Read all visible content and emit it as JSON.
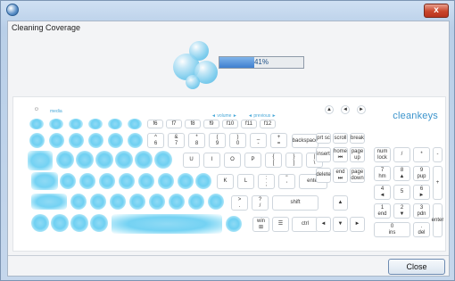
{
  "window": {
    "title_icon": "app-icon",
    "close_glyph": "x"
  },
  "section": {
    "title": "Cleaning Coverage"
  },
  "progress": {
    "percent": 41,
    "label": "41%"
  },
  "brand": {
    "logo": "cleankeys"
  },
  "labels": {
    "media": "media",
    "volume": "◄ volume ►",
    "previous": "◄ previous ►",
    "power": "⏻"
  },
  "keys": {
    "f6": "f6",
    "f7": "f7",
    "f8": "f8",
    "f9": "f9",
    "f10": "f10",
    "f11": "f11",
    "f12": "f12",
    "row2": [
      {
        "top": "^",
        "bottom": "6"
      },
      {
        "top": "&",
        "bottom": "7"
      },
      {
        "top": "*",
        "bottom": "8"
      },
      {
        "top": "(",
        "bottom": "9"
      },
      {
        "top": ")",
        "bottom": "0"
      },
      {
        "top": "_",
        "bottom": "-"
      },
      {
        "top": "+",
        "bottom": "="
      }
    ],
    "backspace": "backspace",
    "row3": [
      "U",
      "I",
      "O",
      "P"
    ],
    "brackets": [
      {
        "top": "{",
        "bottom": "["
      },
      {
        "top": "}",
        "bottom": "]"
      },
      {
        "top": "|",
        "bottom": "\\"
      }
    ],
    "row4": [
      "K",
      "L"
    ],
    "semicolon": {
      "top": ":",
      "bottom": ";"
    },
    "quote": {
      "top": "\"",
      "bottom": "'"
    },
    "enter": "enter",
    "row5a": {
      "top": ">",
      "bottom": "."
    },
    "row5b": {
      "top": "?",
      "bottom": "/"
    },
    "shift": "shift",
    "win": {
      "top": "win",
      "bottom": "⊞"
    },
    "menu": "☰",
    "ctrl": "ctrl",
    "nav_top": [
      "prt sc",
      "scroll",
      "break"
    ],
    "nav_mid": [
      {
        "top": "insert",
        "bottom": ""
      },
      {
        "top": "home",
        "bottom": "⏮"
      },
      {
        "top": "page",
        "bottom": "up"
      }
    ],
    "nav_bot": [
      {
        "top": "delete",
        "bottom": ""
      },
      {
        "top": "end",
        "bottom": "⏭"
      },
      {
        "top": "page",
        "bottom": "down"
      }
    ],
    "arrows": [
      "▲",
      "◄",
      "▼",
      "►"
    ],
    "numpad": {
      "num_lock": {
        "top": "num",
        "bottom": "lock"
      },
      "div": "/",
      "mul": "*",
      "minus": "-",
      "n7": {
        "top": "7",
        "bottom": "hm"
      },
      "n8": {
        "top": "8",
        "bottom": "▲"
      },
      "n9": {
        "top": "9",
        "bottom": "pup"
      },
      "plus": "+",
      "n4": {
        "top": "4",
        "bottom": "◄"
      },
      "n5": {
        "top": "5",
        "bottom": ""
      },
      "n6": {
        "top": "6",
        "bottom": "►"
      },
      "n1": {
        "top": "1",
        "bottom": "end"
      },
      "n2": {
        "top": "2",
        "bottom": "▼"
      },
      "n3": {
        "top": "3",
        "bottom": "pdn"
      },
      "n0": {
        "top": "0",
        "bottom": "ins"
      },
      "ndot": {
        "top": ".",
        "bottom": "del"
      },
      "enter": "enter"
    },
    "media_buttons": [
      "▲",
      "◄",
      "►"
    ]
  },
  "footer": {
    "close_label": "Close"
  }
}
